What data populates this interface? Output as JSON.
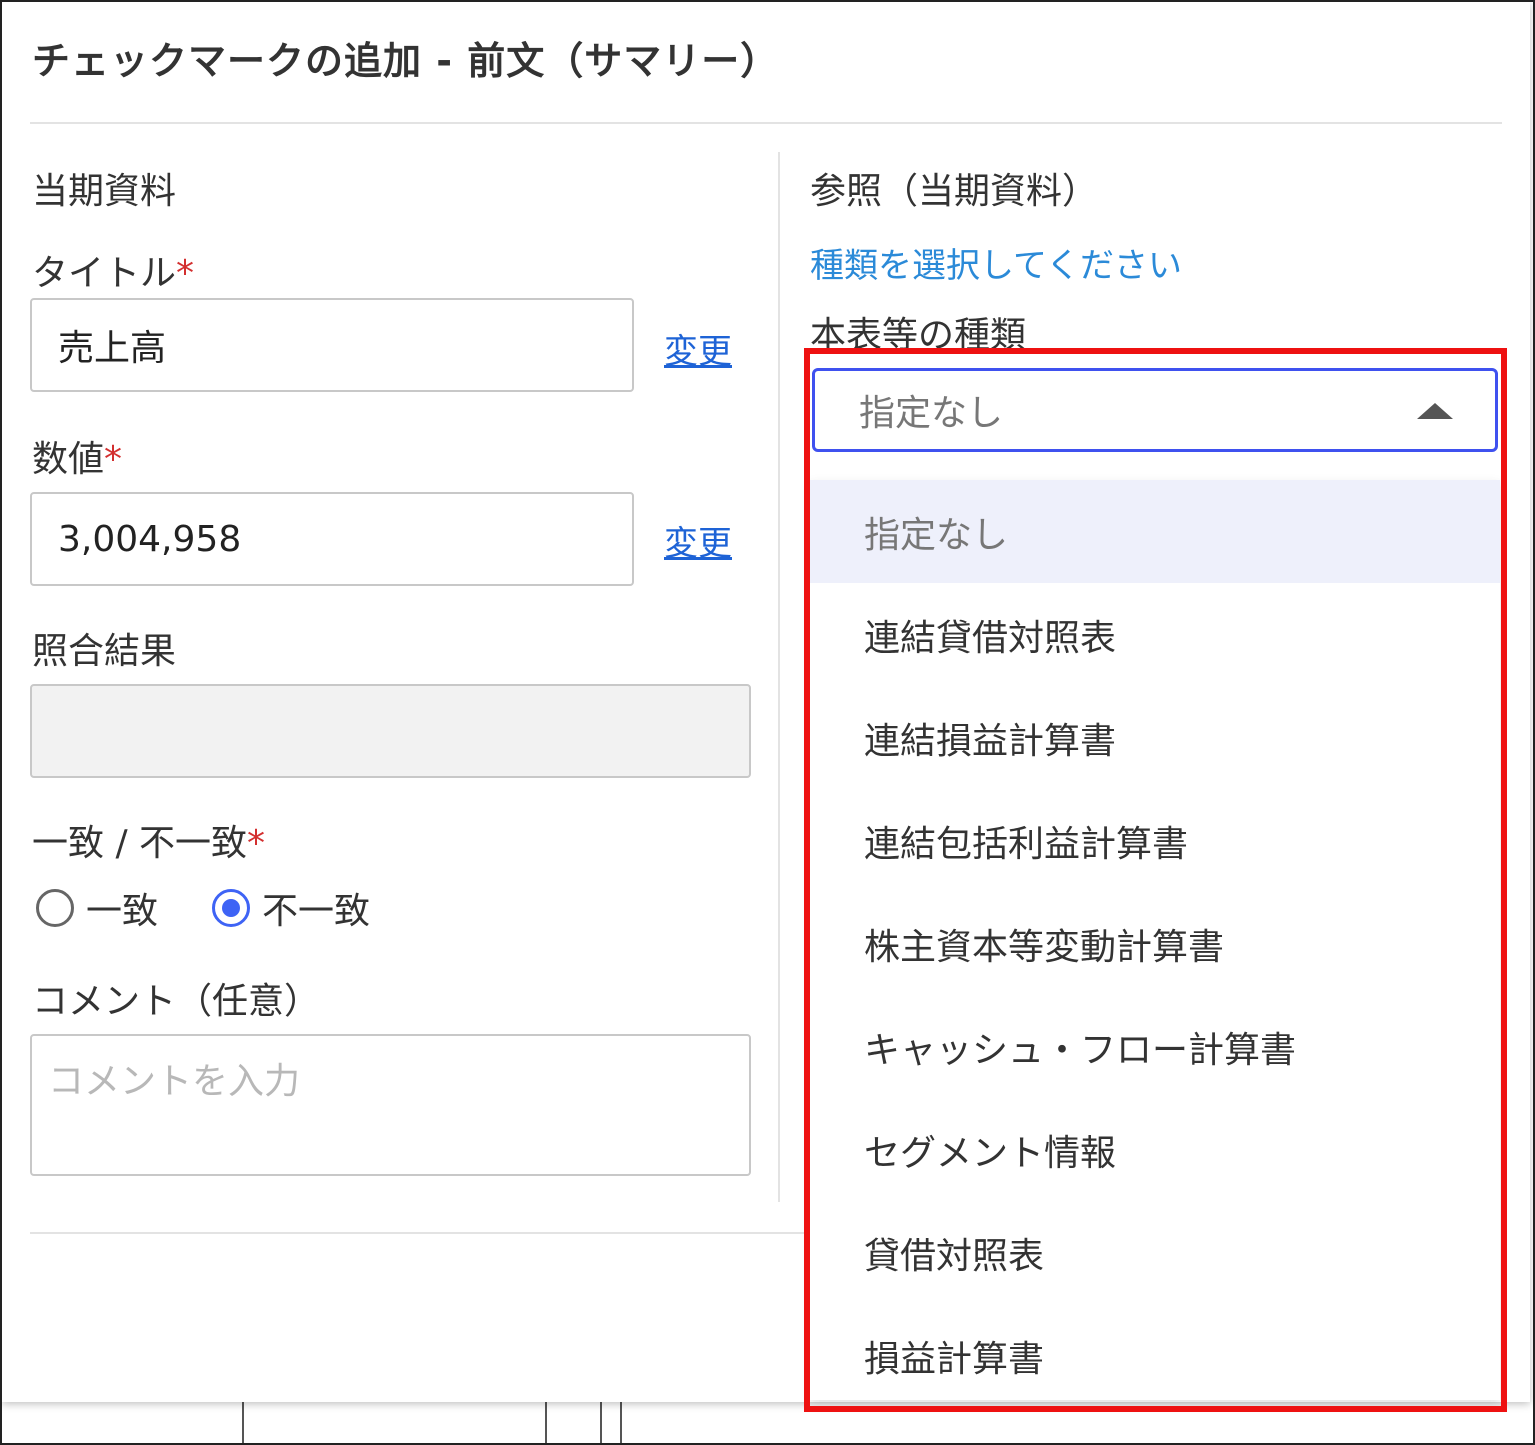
{
  "dialog": {
    "title": "チェックマークの追加 - 前文（サマリー）"
  },
  "current": {
    "section_title": "当期資料",
    "title_label": "タイトル",
    "title_value": "売上高",
    "title_change": "変更",
    "value_label": "数値",
    "value_value": "3,004,958",
    "value_change": "変更",
    "match_result_label": "照合結果",
    "match_result_value": "",
    "consistency_label": "一致 / 不一致",
    "radio_match": "一致",
    "radio_mismatch": "不一致",
    "selected_radio": "不一致",
    "comment_label": "コメント（任意）",
    "comment_placeholder": "コメントを入力",
    "required_mark": "*"
  },
  "reference": {
    "section_title": "参照（当期資料）",
    "select_type_link": "種類を選択してください",
    "statement_type_label": "本表等の種類",
    "select_value": "指定なし",
    "options": [
      "指定なし",
      "連結貸借対照表",
      "連結損益計算書",
      "連結包括利益計算書",
      "株主資本等変動計算書",
      "キャッシュ・フロー計算書",
      "セグメント情報",
      "貸借対照表",
      "損益計算書"
    ]
  },
  "colors": {
    "accent": "#3f51ef",
    "link": "#1e63d6",
    "required": "#d32f2f",
    "highlight": "#ee1111",
    "selected_option_bg": "#eef0fb"
  },
  "icons": {
    "dropdown_caret": "caret-up-icon"
  }
}
